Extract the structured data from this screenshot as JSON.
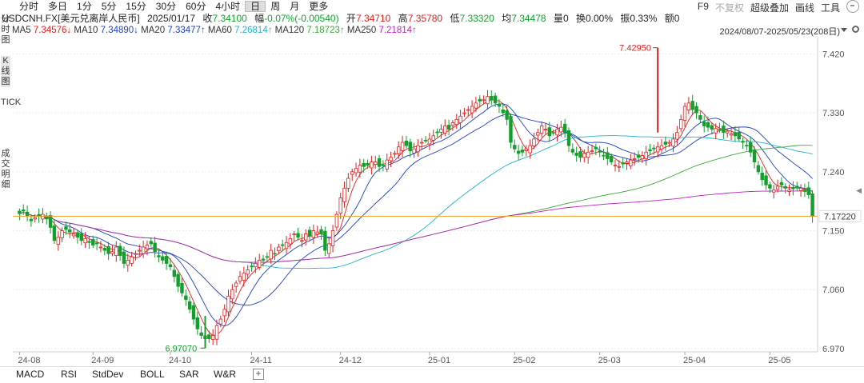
{
  "top_tabs": [
    "分时",
    "多日",
    "1分",
    "5分",
    "15分",
    "30分",
    "60分",
    "4小时",
    "日",
    "周",
    "月",
    "更多"
  ],
  "active_tab": "日",
  "right_tools": {
    "f9": "F9",
    "no_adjust": "不复权",
    "overlay": "超级叠加",
    "draw": "画线",
    "tools": "工具"
  },
  "quote": {
    "symbol": "USDCNH.FX[美元兑离岸人民币]",
    "date": "2025/01/17",
    "close_label": "收",
    "close": "7.34100",
    "amp_label": "幅",
    "change": "-0.07%(-0.00540)",
    "open_label": "开",
    "open": "7.34710",
    "high_label": "高",
    "high": "7.35780",
    "low_label": "低",
    "low": "7.33320",
    "avg_label": "均",
    "avg": "7.34478",
    "vol_label": "量",
    "vol": "0",
    "turnover_label": "换",
    "turnover": "0.00%",
    "swing_label": "振",
    "swing": "0.33%",
    "amount_label": "额",
    "amount": "0"
  },
  "ma_legend": [
    {
      "label": "MA5",
      "value": "7.34576↓",
      "color": "#e02020"
    },
    {
      "label": "MA10",
      "value": "7.34890↓",
      "color": "#1f3fbf"
    },
    {
      "label": "MA20",
      "value": "7.33477↑",
      "color": "#1f3fbf"
    },
    {
      "label": "MA60",
      "value": "7.26814↑",
      "color": "#20b2c8"
    },
    {
      "label": "MA120",
      "value": "7.18723↑",
      "color": "#3aa83a"
    },
    {
      "label": "MA250",
      "value": "7.21814↑",
      "color": "#c020c0"
    }
  ],
  "date_range": "2024/08/07-2025/05/23(208日)",
  "sidebar": {
    "tick_chart": "分时图",
    "k_chart": "K线图",
    "tick": "TICK",
    "deals": "成交明细"
  },
  "bottom_tabs": [
    "MACD",
    "RSI",
    "StdDev",
    "BOLL",
    "SAR",
    "W&R"
  ],
  "plus": "+",
  "colors": {
    "up": "#e02020",
    "down": "#129f2c",
    "ref_line": "#f0a020"
  },
  "chart_data": {
    "type": "candlestick",
    "y_ticks": [
      "7.420",
      "7.330",
      "7.240",
      "7.150",
      "7.060",
      "6.970"
    ],
    "y_range": [
      6.965,
      7.445
    ],
    "x_ticks": [
      "24-08",
      "24-09",
      "24-10",
      "24-11",
      "24-12",
      "25-01",
      "25-02",
      "25-03",
      "25-04",
      "25-05"
    ],
    "max_label": "7.42950",
    "min_label": "6.97070",
    "last_price_label": "7.17220",
    "last_price": 7.1722,
    "close_series": [
      7.176,
      7.18,
      7.173,
      7.165,
      7.17,
      7.172,
      7.175,
      7.168,
      7.155,
      7.135,
      7.14,
      7.15,
      7.152,
      7.148,
      7.145,
      7.14,
      7.135,
      7.138,
      7.132,
      7.128,
      7.13,
      7.125,
      7.12,
      7.115,
      7.118,
      7.125,
      7.112,
      7.1,
      7.105,
      7.11,
      7.115,
      7.12,
      7.125,
      7.128,
      7.13,
      7.118,
      7.11,
      7.105,
      7.1,
      7.095,
      7.08,
      7.065,
      7.055,
      7.045,
      7.03,
      7.015,
      7.0,
      6.99,
      6.985,
      6.985,
      6.99,
      7.005,
      7.015,
      7.03,
      7.05,
      7.06,
      7.07,
      7.08,
      7.085,
      7.09,
      7.095,
      7.1,
      7.105,
      7.105,
      7.11,
      7.12,
      7.115,
      7.125,
      7.128,
      7.132,
      7.138,
      7.145,
      7.14,
      7.135,
      7.145,
      7.142,
      7.15,
      7.148,
      7.145,
      7.12,
      7.13,
      7.15,
      7.175,
      7.2,
      7.215,
      7.23,
      7.24,
      7.245,
      7.25,
      7.248,
      7.25,
      7.255,
      7.255,
      7.248,
      7.25,
      7.258,
      7.262,
      7.268,
      7.278,
      7.285,
      7.28,
      7.272,
      7.275,
      7.28,
      7.285,
      7.288,
      7.29,
      7.295,
      7.3,
      7.305,
      7.31,
      7.305,
      7.315,
      7.32,
      7.325,
      7.33,
      7.335,
      7.34,
      7.345,
      7.348,
      7.35,
      7.355,
      7.35,
      7.345,
      7.34,
      7.33,
      7.32,
      7.285,
      7.275,
      7.268,
      7.27,
      7.275,
      7.28,
      7.29,
      7.3,
      7.31,
      7.305,
      7.295,
      7.3,
      7.305,
      7.308,
      7.3,
      7.28,
      7.27,
      7.265,
      7.262,
      7.268,
      7.27,
      7.272,
      7.275,
      7.27,
      7.265,
      7.26,
      7.255,
      7.25,
      7.248,
      7.252,
      7.255,
      7.258,
      7.26,
      7.262,
      7.265,
      7.27,
      7.272,
      7.275,
      7.278,
      7.28,
      7.282,
      7.285,
      7.29,
      7.3,
      7.32,
      7.34,
      7.345,
      7.335,
      7.33,
      7.32,
      7.31,
      7.308,
      7.305,
      7.306,
      7.304,
      7.3,
      7.302,
      7.298,
      7.295,
      7.29,
      7.285,
      7.28,
      7.27,
      7.255,
      7.24,
      7.228,
      7.22,
      7.215,
      7.212,
      7.218,
      7.22,
      7.215,
      7.212,
      7.214,
      7.216,
      7.215,
      7.21,
      7.205,
      7.172
    ],
    "ma_series_names": [
      "MA5",
      "MA10",
      "MA20",
      "MA60",
      "MA120",
      "MA250"
    ]
  }
}
